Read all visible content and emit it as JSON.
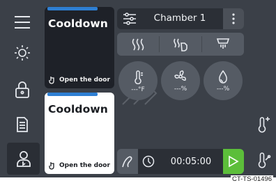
{
  "nav": {
    "items": [
      {
        "icon": "menu-icon"
      },
      {
        "icon": "brightness-icon"
      },
      {
        "icon": "lock-icon"
      },
      {
        "icon": "document-icon"
      },
      {
        "icon": "user-icon"
      }
    ]
  },
  "cards": [
    {
      "title": "Cooldown",
      "door_text": "Open the door",
      "theme": "dark"
    },
    {
      "title": "Cooldown",
      "door_text": "Open the door",
      "theme": "light"
    }
  ],
  "header": {
    "chamber": "Chamber 1"
  },
  "modes": [
    {
      "icon": "heat-waves-icon"
    },
    {
      "icon": "steam-hand-icon"
    },
    {
      "icon": "drip-hand-icon"
    }
  ],
  "readings": {
    "temperature": "---°F",
    "fan": "---%",
    "humidity": "---%"
  },
  "timer": {
    "value": "00:05:00"
  },
  "colors": {
    "accent_blue": "#2e7fd3",
    "play_green": "#5cbe3a",
    "bg": "#3b4048"
  },
  "caption": "CT-TS-01496"
}
